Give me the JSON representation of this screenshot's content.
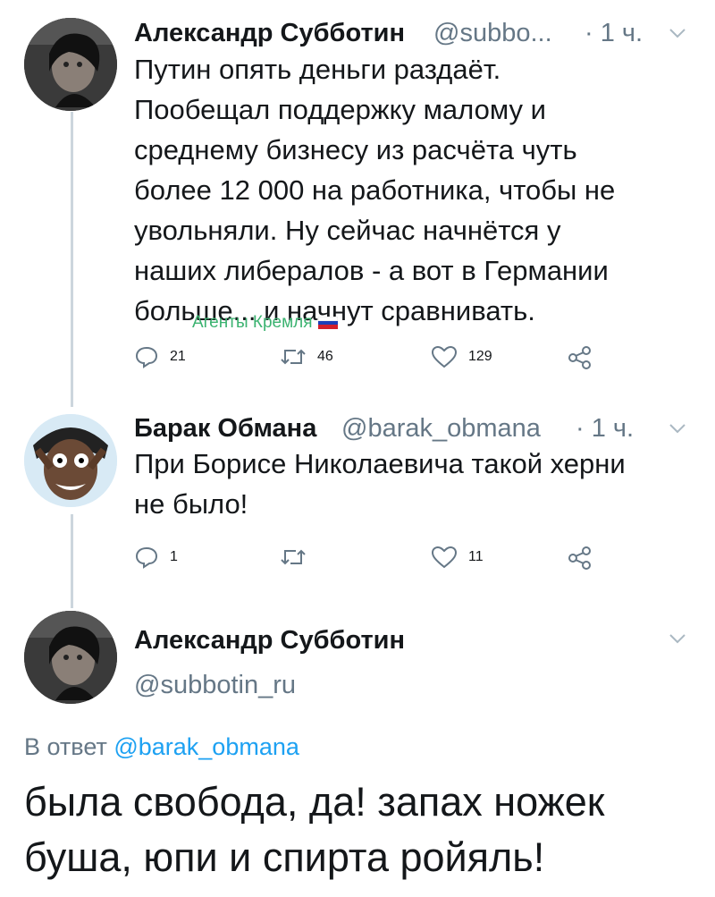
{
  "tweets": [
    {
      "author": "Александр Субботин",
      "handle": "@subbo...",
      "time": "· 1 ч.",
      "lines": [
        "Путин опять деньги раздаёт.",
        "Пообещал поддержку малому и",
        "среднему бизнесу из расчёта чуть",
        "более 12 000 на работника, чтобы не",
        "увольняли. Ну сейчас начнётся у",
        "наших либералов - а вот в Германии",
        "больше... и начнут сравнивать."
      ],
      "replies": "21",
      "retweets": "46",
      "likes": "129"
    },
    {
      "author": "Барак Обмана",
      "handle": "@barak_obmana",
      "time": "· 1 ч.",
      "lines": [
        "При Борисе Николаевича такой херни",
        "не было!"
      ],
      "replies": "1",
      "retweets": "",
      "likes": "11"
    }
  ],
  "watermark": "Агенты Кремля",
  "main_tweet": {
    "author": "Александр Субботин",
    "handle": "@subbotin_ru",
    "reply_prefix": "В ответ",
    "reply_to": "@barak_obmana",
    "lines": [
      "была свобода, да! запах ножек",
      "буша, юпи и спирта ройяль!"
    ]
  },
  "icons": {
    "reply": "reply-icon",
    "retweet": "retweet-icon",
    "like": "heart-icon",
    "share": "share-icon",
    "menu": "chevron-down-icon"
  },
  "colors": {
    "muted": "#657786",
    "link": "#1da1f2",
    "line": "#ccd6dd",
    "watermark": "#3cb371"
  }
}
